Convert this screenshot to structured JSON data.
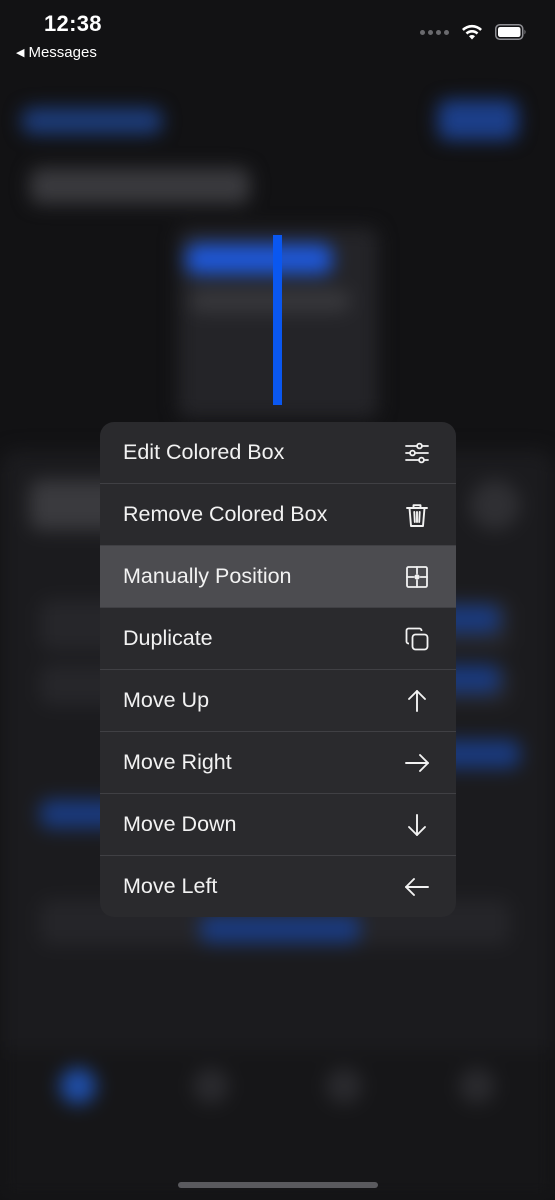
{
  "status_bar": {
    "time": "12:38",
    "back_label": "Messages",
    "back_icon": "back-triangle-icon"
  },
  "selected_view": {
    "color": "#0a57f0"
  },
  "menu": {
    "highlighted_index": 2,
    "items": [
      {
        "label": "Edit Colored Box",
        "icon": "sliders-icon"
      },
      {
        "label": "Remove Colored Box",
        "icon": "trash-icon"
      },
      {
        "label": "Manually Position",
        "icon": "position-target-icon"
      },
      {
        "label": "Duplicate",
        "icon": "duplicate-icon"
      },
      {
        "label": "Move Up",
        "icon": "arrow-up-icon"
      },
      {
        "label": "Move Right",
        "icon": "arrow-right-icon"
      },
      {
        "label": "Move Down",
        "icon": "arrow-down-icon"
      },
      {
        "label": "Move Left",
        "icon": "arrow-left-icon"
      }
    ]
  },
  "colors": {
    "menu_background": "#2a2a2d",
    "menu_highlight": "#4c4c50",
    "accent_blue": "#0a57f0"
  }
}
